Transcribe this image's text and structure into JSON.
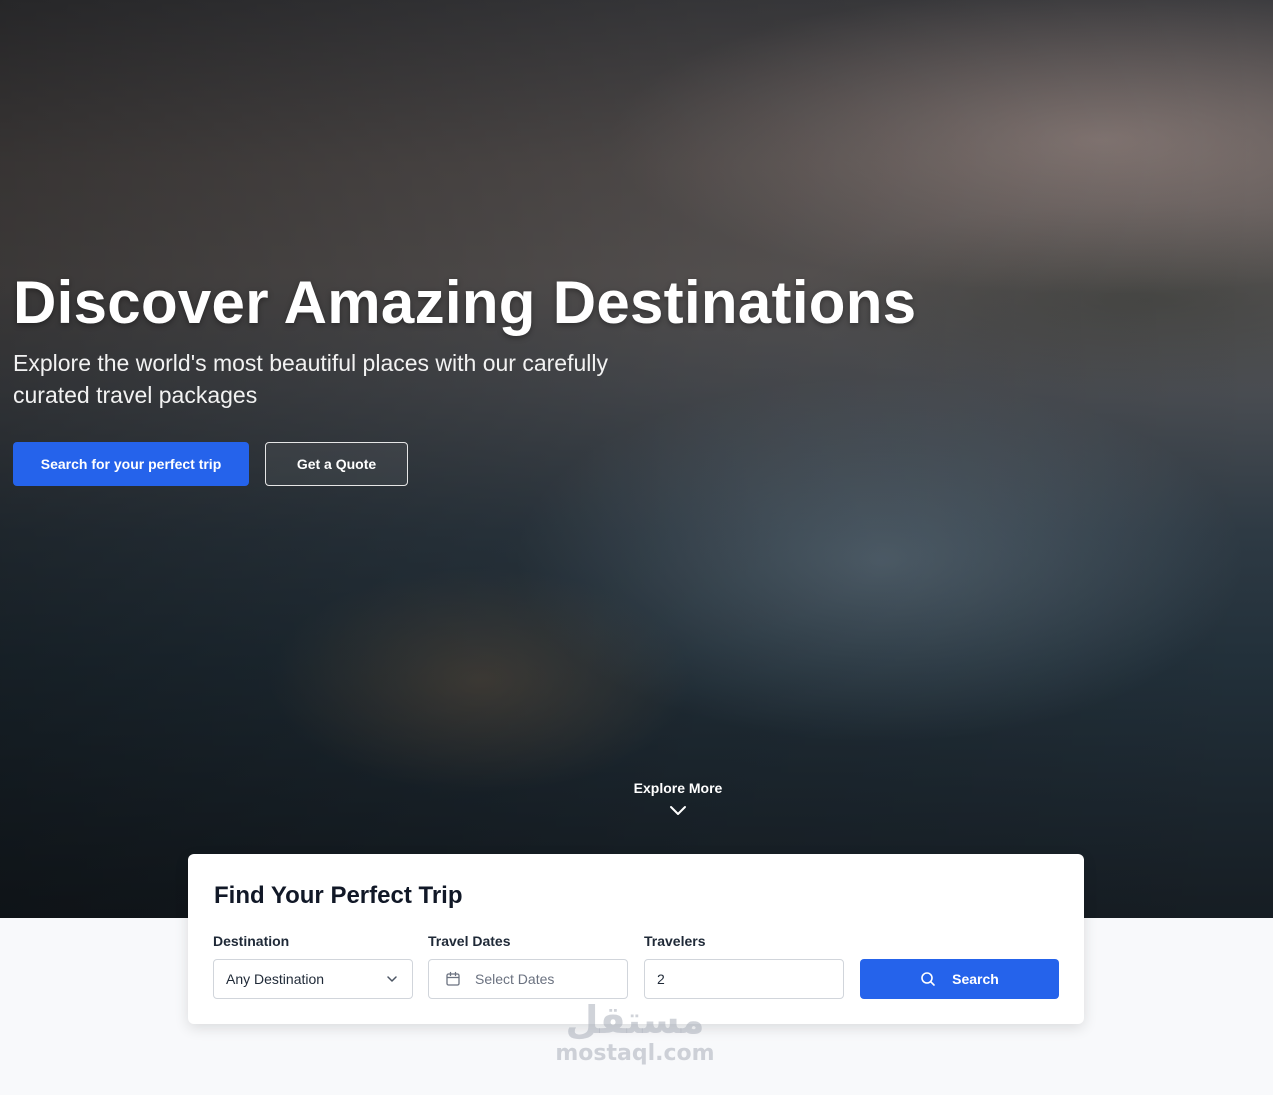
{
  "hero": {
    "title": "Discover Amazing Destinations",
    "subtitle": "Explore the world's most beautiful places with our carefully curated travel packages",
    "primary_button": "Search for your perfect trip",
    "secondary_button": "Get a Quote",
    "explore_label": "Explore More",
    "explore_icon": "chevron-down-icon"
  },
  "search_card": {
    "title": "Find Your Perfect Trip",
    "destination": {
      "label": "Destination",
      "value": "Any Destination",
      "icon": "chevron-down-icon"
    },
    "dates": {
      "label": "Travel Dates",
      "placeholder": "Select Dates",
      "icon": "calendar-icon"
    },
    "travelers": {
      "label": "Travelers",
      "value": "2"
    },
    "search_button": {
      "label": "Search",
      "icon": "search-icon"
    }
  },
  "watermark": {
    "arabic": "مستقل",
    "text": "mostaql.com"
  },
  "colors": {
    "accent": "#2563eb",
    "page_background": "#f8f9fb",
    "card_background": "#ffffff"
  }
}
